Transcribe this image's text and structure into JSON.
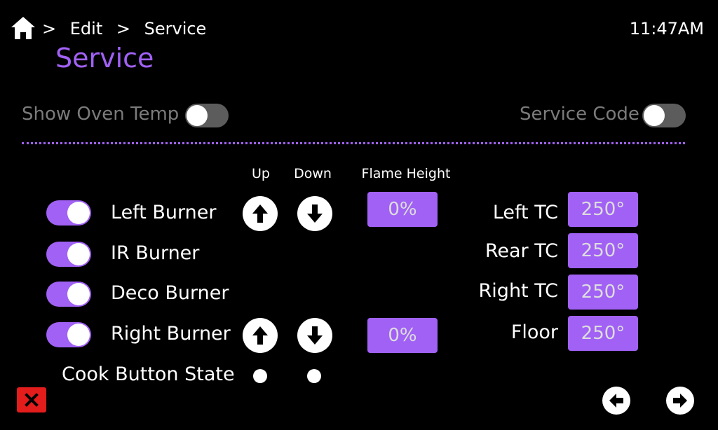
{
  "header": {
    "breadcrumb": [
      ">",
      "Edit",
      ">",
      "Service"
    ],
    "title": "Service",
    "time": "11:47AM",
    "home_icon": "home-icon"
  },
  "top_controls": {
    "show_oven_temp": {
      "label": "Show Oven Temp",
      "on": false
    },
    "service_code": {
      "label": "Service Code",
      "on": false
    }
  },
  "columns": {
    "up": "Up",
    "down": "Down",
    "flame_height": "Flame Height"
  },
  "burners": [
    {
      "label": "Left Burner",
      "on": true,
      "flame_height": "0%"
    },
    {
      "label": "IR Burner",
      "on": true
    },
    {
      "label": "Deco Burner",
      "on": true
    },
    {
      "label": "Right Burner",
      "on": true,
      "flame_height": "0%"
    }
  ],
  "cook_button_state": {
    "label": "Cook Button State"
  },
  "thermocouples": [
    {
      "label": "Left TC",
      "value": "250°"
    },
    {
      "label": "Rear TC",
      "value": "250°"
    },
    {
      "label": "Right TC",
      "value": "250°"
    },
    {
      "label": "Floor",
      "value": "250°"
    }
  ],
  "colors": {
    "accent": "#a161f5",
    "background": "#000000",
    "close": "#e31c1c",
    "toggle_off": "#5c5c5c",
    "dim_text": "#7b7b7b"
  },
  "icons": {
    "up": "arrow-up-icon",
    "down": "arrow-down-icon",
    "back": "arrow-left-icon",
    "forward": "arrow-right-icon",
    "close": "close-icon"
  }
}
